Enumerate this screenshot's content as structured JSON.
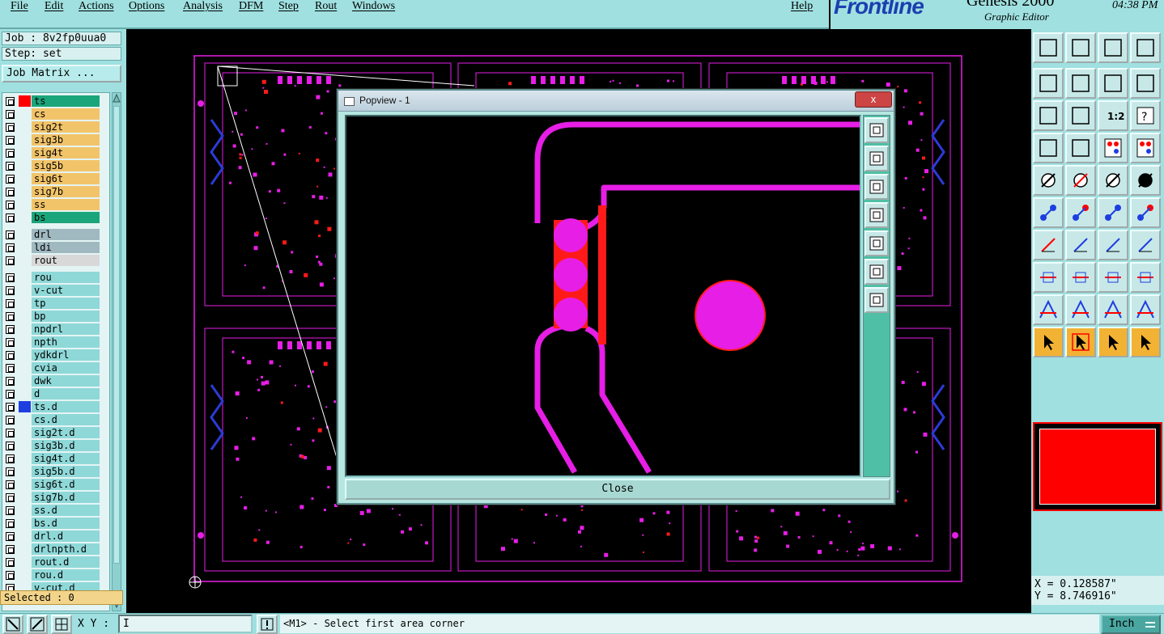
{
  "menubar": {
    "items": [
      "File",
      "Edit",
      "Actions",
      "Options",
      "Analysis",
      "DFM",
      "Step",
      "Rout",
      "Windows"
    ],
    "help": "Help"
  },
  "brand": {
    "logo": "Frontline",
    "product": "Genesis 2000",
    "subtitle": "Graphic Editor",
    "time": "04:38 PM"
  },
  "job": {
    "label": "Job : 8v2fp0uua0",
    "step": "Step: set",
    "matrix_button": "Job Matrix ..."
  },
  "layers": [
    {
      "name": "ts",
      "color": "#1aa57a",
      "sel": "#ff0000"
    },
    {
      "name": "cs",
      "color": "#f2c46a"
    },
    {
      "name": "sig2t",
      "color": "#f2c46a"
    },
    {
      "name": "sig3b",
      "color": "#f2c46a"
    },
    {
      "name": "sig4t",
      "color": "#f2c46a"
    },
    {
      "name": "sig5b",
      "color": "#f2c46a"
    },
    {
      "name": "sig6t",
      "color": "#f2c46a"
    },
    {
      "name": "sig7b",
      "color": "#f2c46a"
    },
    {
      "name": "ss",
      "color": "#f2c46a"
    },
    {
      "name": "bs",
      "color": "#1aa57a"
    },
    {
      "name": "drl",
      "color": "#a0b8c0"
    },
    {
      "name": "ldi",
      "color": "#a0b8c0"
    },
    {
      "name": "rout",
      "color": "#d8d8d8"
    },
    {
      "name": "rou",
      "color": "#8fd8d8"
    },
    {
      "name": "v-cut",
      "color": "#8fd8d8"
    },
    {
      "name": "tp",
      "color": "#8fd8d8"
    },
    {
      "name": "bp",
      "color": "#8fd8d8"
    },
    {
      "name": "npdrl",
      "color": "#8fd8d8"
    },
    {
      "name": "npth",
      "color": "#8fd8d8"
    },
    {
      "name": "ydkdrl",
      "color": "#8fd8d8"
    },
    {
      "name": "cvia",
      "color": "#8fd8d8"
    },
    {
      "name": "dwk",
      "color": "#8fd8d8"
    },
    {
      "name": "d",
      "color": "#8fd8d8"
    },
    {
      "name": "ts.d",
      "color": "#8fd8d8",
      "sel": "#1d3fe0"
    },
    {
      "name": "cs.d",
      "color": "#8fd8d8"
    },
    {
      "name": "sig2t.d",
      "color": "#8fd8d8"
    },
    {
      "name": "sig3b.d",
      "color": "#8fd8d8"
    },
    {
      "name": "sig4t.d",
      "color": "#8fd8d8"
    },
    {
      "name": "sig5b.d",
      "color": "#8fd8d8"
    },
    {
      "name": "sig6t.d",
      "color": "#8fd8d8"
    },
    {
      "name": "sig7b.d",
      "color": "#8fd8d8"
    },
    {
      "name": "ss.d",
      "color": "#8fd8d8"
    },
    {
      "name": "bs.d",
      "color": "#8fd8d8"
    },
    {
      "name": "drl.d",
      "color": "#8fd8d8"
    },
    {
      "name": "drlnpth.d",
      "color": "#8fd8d8"
    },
    {
      "name": "rout.d",
      "color": "#8fd8d8"
    },
    {
      "name": "rou.d",
      "color": "#8fd8d8"
    },
    {
      "name": "v-cut.d",
      "color": "#8fd8d8"
    }
  ],
  "selected": "Selected : 0",
  "popview": {
    "title": "Popview - 1",
    "close_x": "x",
    "close_button": "Close"
  },
  "coords": {
    "x": "X = 0.128587\"",
    "y": "Y = 8.746916\""
  },
  "bottom": {
    "xy_label": "X Y :",
    "xy_value": "I",
    "prompt": "<M1> - Select first area corner",
    "unit": "Inch"
  },
  "colors": {
    "panel": "#a0e0e0",
    "trace": "#e61ee6",
    "pad": "#ff1a1a",
    "accent": "#ff0000"
  }
}
